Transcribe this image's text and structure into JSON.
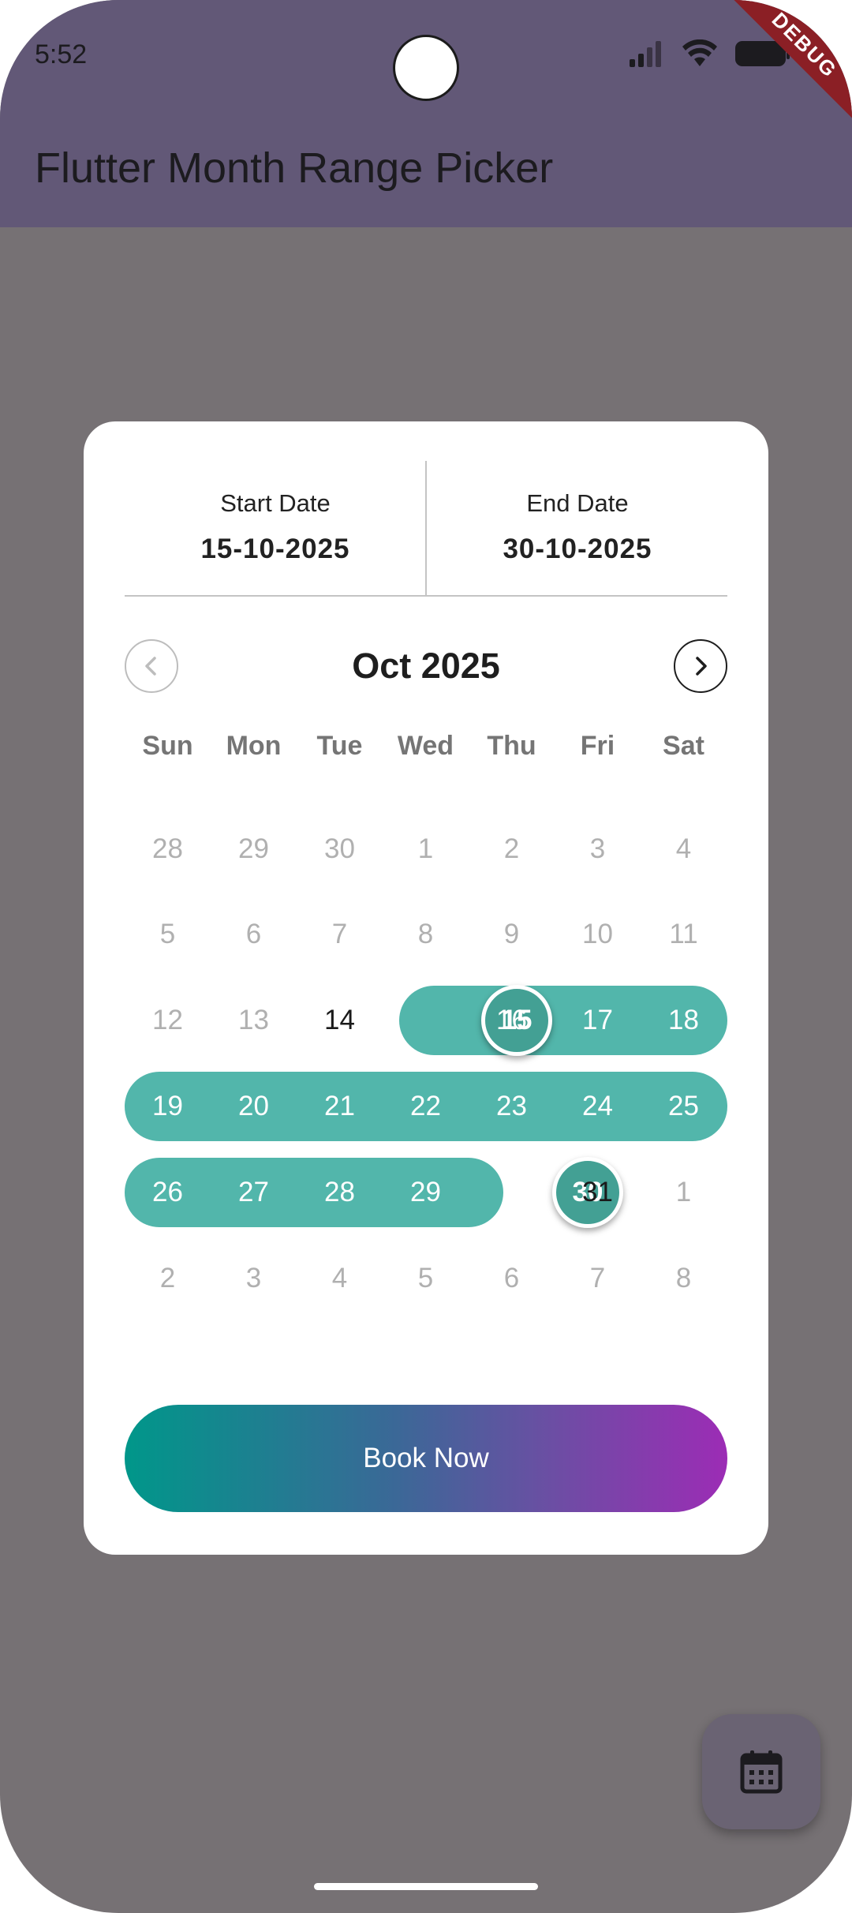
{
  "status_bar": {
    "time": "5:52",
    "debug_label": "DEBUG"
  },
  "app_bar": {
    "title": "Flutter Month Range Picker"
  },
  "picker": {
    "start_label": "Start Date",
    "start_value": "15-10-2025",
    "end_label": "End Date",
    "end_value": "30-10-2025",
    "month_title": "Oct 2025",
    "weekdays": [
      "Sun",
      "Mon",
      "Tue",
      "Wed",
      "Thu",
      "Fri",
      "Sat"
    ],
    "weeks": [
      [
        "28",
        "29",
        "30",
        "1",
        "2",
        "3",
        "4"
      ],
      [
        "5",
        "6",
        "7",
        "8",
        "9",
        "10",
        "11"
      ],
      [
        "12",
        "13",
        "14",
        "15",
        "16",
        "17",
        "18"
      ],
      [
        "19",
        "20",
        "21",
        "22",
        "23",
        "24",
        "25"
      ],
      [
        "26",
        "27",
        "28",
        "29",
        "30",
        "31",
        "1"
      ],
      [
        "2",
        "3",
        "4",
        "5",
        "6",
        "7",
        "8"
      ]
    ],
    "book_label": "Book Now"
  },
  "icons": {
    "prev": "chevron-left-icon",
    "next": "chevron-right-icon",
    "fab": "calendar-icon"
  },
  "colors": {
    "app_bar": "#625877",
    "range": "#52b6ab",
    "range_endpoint": "#43a094",
    "button_gradient_start": "#00978a",
    "button_gradient_end": "#9c2cb5"
  }
}
